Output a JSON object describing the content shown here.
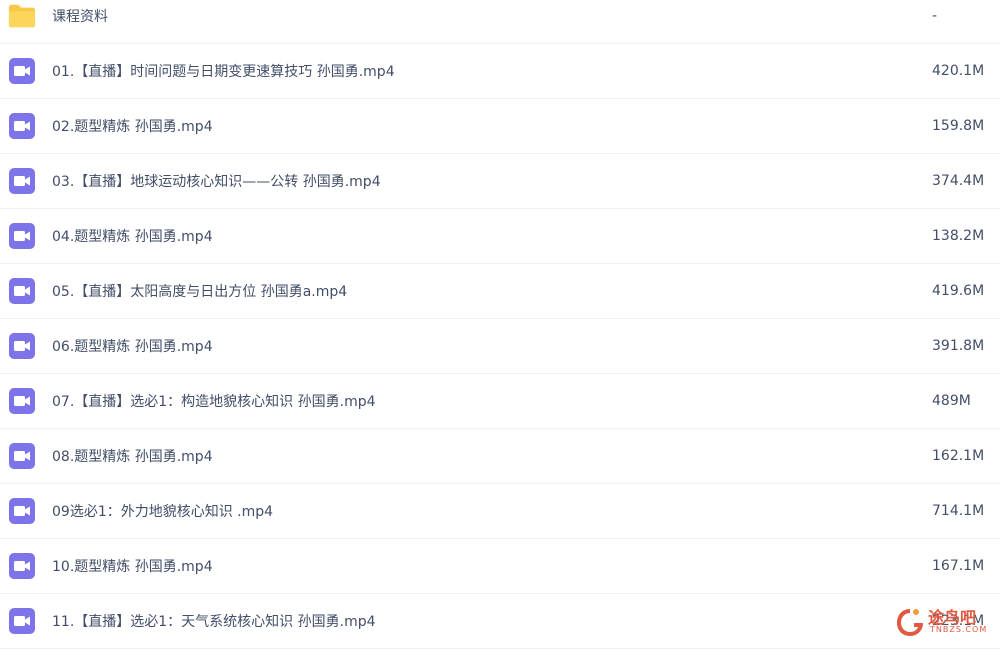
{
  "files": [
    {
      "type": "folder",
      "icon": "folder-icon",
      "name": "课程资料",
      "size": "-"
    },
    {
      "type": "video",
      "icon": "video-file-icon",
      "name": "01.【直播】时间问题与日期变更速算技巧 孙国勇.mp4",
      "size": "420.1M"
    },
    {
      "type": "video",
      "icon": "video-file-icon",
      "name": "02.题型精炼 孙国勇.mp4",
      "size": "159.8M"
    },
    {
      "type": "video",
      "icon": "video-file-icon",
      "name": "03.【直播】地球运动核心知识——公转 孙国勇.mp4",
      "size": "374.4M"
    },
    {
      "type": "video",
      "icon": "video-file-icon",
      "name": "04.题型精炼 孙国勇.mp4",
      "size": "138.2M"
    },
    {
      "type": "video",
      "icon": "video-file-icon",
      "name": "05.【直播】太阳高度与日出方位 孙国勇a.mp4",
      "size": "419.6M"
    },
    {
      "type": "video",
      "icon": "video-file-icon",
      "name": "06.题型精炼 孙国勇.mp4",
      "size": "391.8M"
    },
    {
      "type": "video",
      "icon": "video-file-icon",
      "name": "07.【直播】选必1：构造地貌核心知识 孙国勇.mp4",
      "size": "489M"
    },
    {
      "type": "video",
      "icon": "video-file-icon",
      "name": "08.题型精炼 孙国勇.mp4",
      "size": "162.1M"
    },
    {
      "type": "video",
      "icon": "video-file-icon",
      "name": "09选必1：外力地貌核心知识 .mp4",
      "size": "714.1M"
    },
    {
      "type": "video",
      "icon": "video-file-icon",
      "name": "10.题型精炼 孙国勇.mp4",
      "size": "167.1M"
    },
    {
      "type": "video",
      "icon": "video-file-icon",
      "name": "11.【直播】选必1：天气系统核心知识 孙国勇.mp4",
      "size": "223.1M"
    }
  ],
  "watermark": {
    "text": "途鸟吧",
    "sub": "TNBZS.COM"
  },
  "colors": {
    "folder": "#f7c948",
    "video": "#7c74e8",
    "text": "#424e67"
  }
}
